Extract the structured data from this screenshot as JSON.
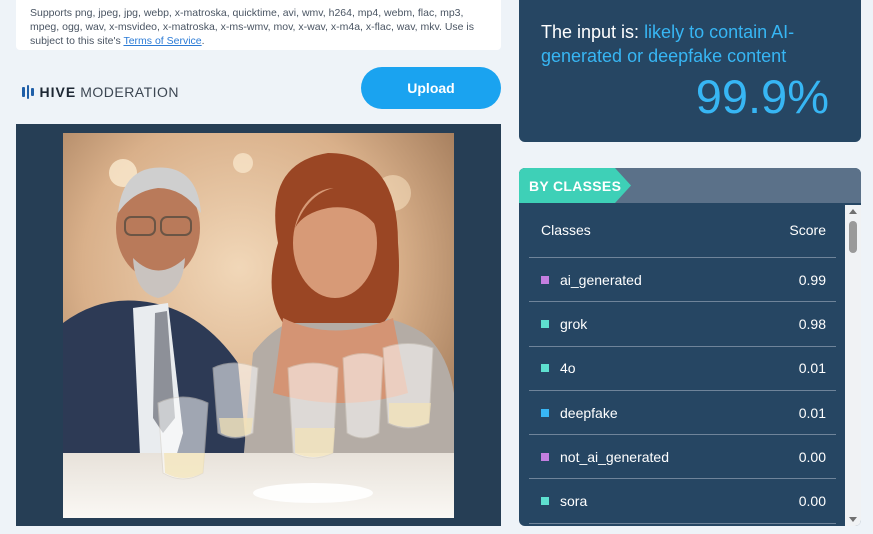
{
  "upload_info": {
    "formats_text": "Supports png, jpeg, jpg, webp, x-matroska, quicktime, avi, wmv, h264, mp4, webm, flac, mp3, mpeg, ogg, wav, x-msvideo, x-matroska, x-ms-wmv, mov, x-wav, x-m4a, x-flac, wav, mkv. Use is subject to this site's ",
    "tos_link": "Terms of Service",
    "tos_suffix": "."
  },
  "brand": {
    "name_bold": "HIVE",
    "name_light": "MODERATION"
  },
  "upload_button": {
    "label": "Upload"
  },
  "result": {
    "prefix": "The input is: ",
    "verdict": "likely to contain AI-generated or deepfake content",
    "percentage": "99.9%"
  },
  "classes_panel": {
    "tab_label": "BY CLASSES",
    "col_classes": "Classes",
    "col_score": "Score",
    "rows": [
      {
        "name": "ai_generated",
        "score": "0.99",
        "color": "#c47fe0"
      },
      {
        "name": "grok",
        "score": "0.98",
        "color": "#5ee0d0"
      },
      {
        "name": "4o",
        "score": "0.01",
        "color": "#5ee0d0"
      },
      {
        "name": "deepfake",
        "score": "0.01",
        "color": "#38b6f4"
      },
      {
        "name": "not_ai_generated",
        "score": "0.00",
        "color": "#c47fe0"
      },
      {
        "name": "sora",
        "score": "0.00",
        "color": "#5ee0d0"
      }
    ]
  },
  "colors": {
    "accent": "#1aa3f0",
    "panel": "#264663",
    "teal": "#3ed0b7",
    "result_text": "#37b6f4"
  }
}
